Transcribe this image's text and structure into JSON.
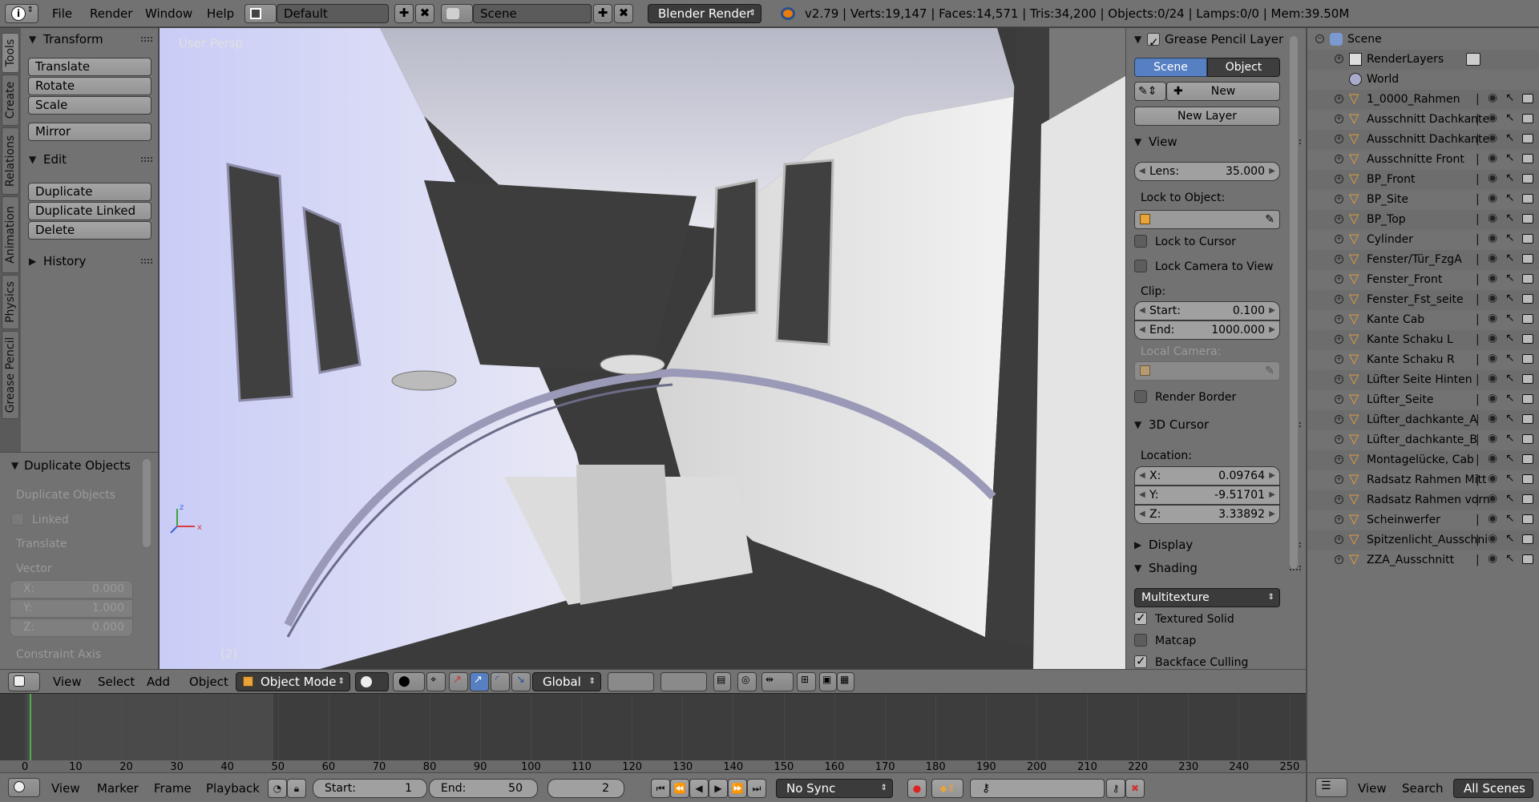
{
  "topbar": {
    "menus": [
      "File",
      "Render",
      "Window",
      "Help"
    ],
    "layout": "Default",
    "scene": "Scene",
    "engine": "Blender Render",
    "status": "v2.79 | Verts:19,147 | Faces:14,571 | Tris:34,200 | Objects:0/24 | Lamps:0/0 | Mem:39.50M"
  },
  "lefttabs": [
    "Tools",
    "Create",
    "Relations",
    "Animation",
    "Physics",
    "Grease Pencil"
  ],
  "toolshelf": {
    "transform": {
      "title": "Transform",
      "buttons": [
        "Translate",
        "Rotate",
        "Scale",
        "Mirror"
      ]
    },
    "edit": {
      "title": "Edit",
      "buttons": [
        "Duplicate",
        "Duplicate Linked",
        "Delete"
      ]
    },
    "history": {
      "title": "History"
    }
  },
  "operator": {
    "title": "Duplicate Objects",
    "subtitle": "Duplicate Objects",
    "linked": "Linked",
    "translate": "Translate",
    "vector": "Vector",
    "x": {
      "label": "X:",
      "value": "0.000"
    },
    "y": {
      "label": "Y:",
      "value": "1.000"
    },
    "z": {
      "label": "Z:",
      "value": "0.000"
    },
    "constraint": "Constraint Axis"
  },
  "viewport": {
    "persp": "User Persp",
    "frame": "(2)"
  },
  "props": {
    "grease": {
      "title": "Grease Pencil Layer",
      "scene": "Scene",
      "object": "Object",
      "new": "New",
      "new_layer": "New Layer"
    },
    "view": {
      "title": "View",
      "lens_label": "Lens:",
      "lens": "35.000",
      "lock_object": "Lock to Object:",
      "lock_cursor": "Lock to Cursor",
      "lock_camera": "Lock Camera to View",
      "clip": "Clip:",
      "start_label": "Start:",
      "start": "0.100",
      "end_label": "End:",
      "end": "1000.000",
      "local_camera": "Local Camera:",
      "render_border": "Render Border"
    },
    "cursor": {
      "title": "3D Cursor",
      "location": "Location:",
      "x_label": "X:",
      "x": "0.09764",
      "y_label": "Y:",
      "y": "-9.51701",
      "z_label": "Z:",
      "z": "3.33892"
    },
    "display": {
      "title": "Display"
    },
    "shading": {
      "title": "Shading",
      "mode": "Multitexture",
      "textured_solid": "Textured Solid",
      "matcap": "Matcap",
      "backface": "Backface Culling"
    }
  },
  "outliner": {
    "root": "Scene",
    "items": [
      "RenderLayers",
      "World",
      "1_0000_Rahmen",
      "Ausschnitt Dachkante",
      "Ausschnitt Dachkante",
      "Ausschnitte Front",
      "BP_Front",
      "BP_Site",
      "BP_Top",
      "Cylinder",
      "Fenster/Tür_FzgA",
      "Fenster_Front",
      "Fenster_Fst_seite",
      "Kante Cab",
      "Kante Schaku L",
      "Kante Schaku R",
      "Lüfter Seite Hinten",
      "Lüfter_Seite",
      "Lüfter_dachkante_A",
      "Lüfter_dachkante_B",
      "Montagelücke, Cab",
      "Radsatz Rahmen Mitt",
      "Radsatz Rahmen vorn",
      "Scheinwerfer",
      "Spitzenlicht_Ausschni",
      "ZZA_Ausschnitt"
    ],
    "header": {
      "view": "View",
      "search": "Search",
      "scenes": "All Scenes"
    }
  },
  "vphdr": {
    "view": "View",
    "select": "Select",
    "add": "Add",
    "object": "Object",
    "mode": "Object Mode",
    "orientation": "Global"
  },
  "timeline": {
    "ticks": [
      "0",
      "10",
      "20",
      "30",
      "40",
      "50",
      "60",
      "70",
      "80",
      "90",
      "100",
      "110",
      "120",
      "130",
      "140",
      "150",
      "160",
      "170",
      "180",
      "190",
      "200",
      "210",
      "220",
      "230",
      "240",
      "250"
    ],
    "current_frame": 2
  },
  "tlhdr": {
    "view": "View",
    "marker": "Marker",
    "frame": "Frame",
    "playback": "Playback",
    "start_label": "Start:",
    "start": "1",
    "end_label": "End:",
    "end": "50",
    "current": "2",
    "sync": "No Sync"
  },
  "colors": {
    "accent": "#5680c2",
    "viewport_bg": "#3b3b3b",
    "panel": "#727272",
    "orange": "#e8a33a"
  }
}
